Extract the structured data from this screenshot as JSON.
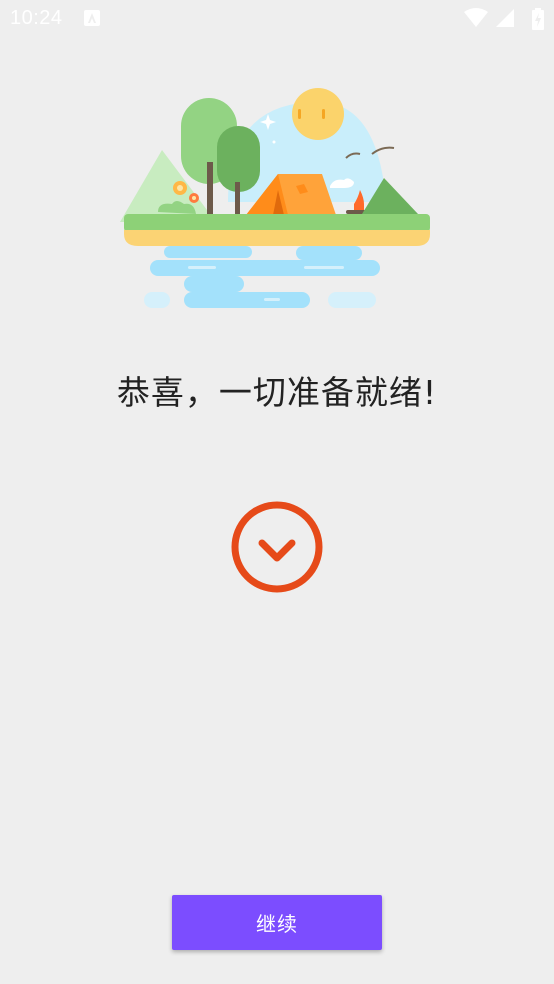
{
  "status_bar": {
    "time": "10:24",
    "left_icon": "notification-a-icon",
    "right_icons": [
      "wifi-icon",
      "cell-signal-icon",
      "battery-charging-icon"
    ]
  },
  "illustration": {
    "name": "camping-island-illustration",
    "colors": {
      "sky": "#c9eefb",
      "sun": "#fbd36b",
      "tree_light": "#93d383",
      "tree_dark": "#6cb15e",
      "tent": "#ffa33a",
      "ground": "#8dd177",
      "sand": "#fbd374",
      "water": "#a3e1fb"
    }
  },
  "headline": "恭喜，一切准备就绪!",
  "status_icon": {
    "name": "check-circle-icon",
    "color": "#e64a19"
  },
  "continue_button": {
    "label": "继续",
    "color": "#7c4dff"
  }
}
